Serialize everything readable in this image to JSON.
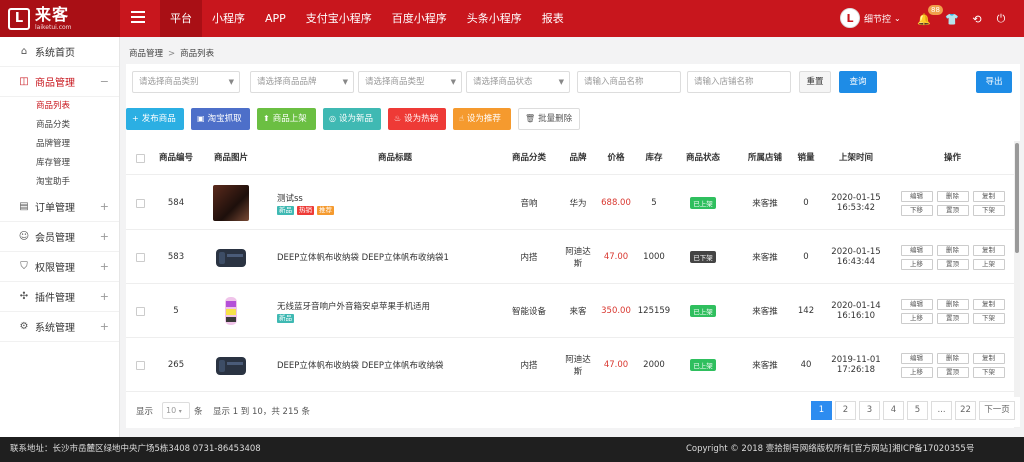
{
  "brand": {
    "logo_cn": "来客",
    "logo_en": "laiketui.com",
    "mark": "L"
  },
  "topnav": [
    "平台",
    "小程序",
    "APP",
    "支付宝小程序",
    "百度小程序",
    "头条小程序",
    "报表"
  ],
  "user": {
    "name": "细节控",
    "avatar_text": "L",
    "notice_count": "88"
  },
  "sidebar": [
    {
      "label": "系统首页",
      "icon": "home-icon",
      "sym": "⌂"
    },
    {
      "label": "商品管理",
      "icon": "shopping-bag-icon",
      "sym": "◫",
      "toggle": "−"
    },
    {
      "label": "订单管理",
      "icon": "order-icon",
      "sym": "▤",
      "toggle": "+"
    },
    {
      "label": "会员管理",
      "icon": "member-icon",
      "sym": "☺",
      "toggle": "+"
    },
    {
      "label": "权限管理",
      "icon": "shield-icon",
      "sym": "⛉",
      "toggle": "+"
    },
    {
      "label": "插件管理",
      "icon": "plugin-icon",
      "sym": "✣",
      "toggle": "+"
    },
    {
      "label": "系统管理",
      "icon": "settings-icon",
      "sym": "⚙",
      "toggle": "+"
    }
  ],
  "submenu": [
    "商品列表",
    "商品分类",
    "品牌管理",
    "库存管理",
    "淘宝助手"
  ],
  "breadcrumb": {
    "parent": "商品管理",
    "sep": ">",
    "current": "商品列表"
  },
  "filters": [
    "请选择商品类别",
    "请选择商品品牌",
    "请选择商品类型",
    "请选择商品状态",
    "请输入商品名称",
    "请输入店铺名称"
  ],
  "buttons": {
    "reset": "重置",
    "query": "查询",
    "export": "导出"
  },
  "actions": [
    {
      "label": "发布商品",
      "icon": "plus-icon",
      "sym": "+",
      "color": "#2bafe3"
    },
    {
      "label": "淘宝抓取",
      "icon": "taobao-icon",
      "sym": "▣",
      "color": "#4d6fc9"
    },
    {
      "label": "商品上架",
      "icon": "upload-icon",
      "sym": "⬆",
      "color": "#6bbf42"
    },
    {
      "label": "设为新品",
      "icon": "new-icon",
      "sym": "◎",
      "color": "#3fb9b3"
    },
    {
      "label": "设为热销",
      "icon": "fire-icon",
      "sym": "♨",
      "color": "#ee3a36"
    },
    {
      "label": "设为推荐",
      "icon": "thumb-up-icon",
      "sym": "☝",
      "color": "#f59a2e"
    },
    {
      "label": "批量删除",
      "icon": "trash-icon",
      "sym": "🗑",
      "color": "#ffffff"
    }
  ],
  "table": {
    "headers": [
      "商品编号",
      "商品图片",
      "商品标题",
      "商品分类",
      "品牌",
      "价格",
      "库存",
      "商品状态",
      "所属店铺",
      "销量",
      "上架时间",
      "操作"
    ],
    "rows": [
      {
        "id": "584",
        "title": "测试ss",
        "tags": [
          {
            "t": "新品",
            "c": "#3fb9b3"
          },
          {
            "t": "热销",
            "c": "#ee3a36"
          },
          {
            "t": "推荐",
            "c": "#f59a2e"
          }
        ],
        "category": "音响",
        "brand": "华为",
        "price": "688.00",
        "stock": "5",
        "status": "已上架",
        "status_color": "#2fbf5e",
        "shop": "来客推",
        "sales": "0",
        "date": "2020-01-15",
        "time": "16:53:42",
        "img": "dark",
        "ops": [
          "编辑",
          "删除",
          "复制",
          "下移",
          "置顶",
          "下架"
        ]
      },
      {
        "id": "583",
        "title": "DEEP立体帆布收纳袋 DEEP立体帆布收纳袋1",
        "tags": [],
        "category": "内搭",
        "brand": "阿迪达斯",
        "price": "47.00",
        "stock": "1000",
        "status": "已下架",
        "status_color": "#444444",
        "shop": "来客推",
        "sales": "0",
        "date": "2020-01-15",
        "time": "16:43:44",
        "img": "box",
        "ops": [
          "编辑",
          "删除",
          "复制",
          "上移",
          "置顶",
          "上架"
        ]
      },
      {
        "id": "5",
        "title": "无线蓝牙音响户外音箱安卓苹果手机适用",
        "tags": [
          {
            "t": "新品",
            "c": "#3fb9b3"
          }
        ],
        "category": "智能设备",
        "brand": "来客",
        "price": "350.00",
        "stock": "125159",
        "status": "已上架",
        "status_color": "#2fbf5e",
        "shop": "来客推",
        "sales": "142",
        "date": "2020-01-14",
        "time": "16:16:10",
        "img": "speaker",
        "ops": [
          "编辑",
          "删除",
          "复制",
          "上移",
          "置顶",
          "下架"
        ]
      },
      {
        "id": "265",
        "title": "DEEP立体帆布收纳袋 DEEP立体帆布收纳袋",
        "tags": [],
        "category": "内搭",
        "brand": "阿迪达斯",
        "price": "47.00",
        "stock": "2000",
        "status": "已上架",
        "status_color": "#2fbf5e",
        "shop": "来客推",
        "sales": "40",
        "date": "2019-11-01",
        "time": "17:26:18",
        "img": "box",
        "ops": [
          "编辑",
          "删除",
          "复制",
          "上移",
          "置顶",
          "下架"
        ]
      }
    ]
  },
  "pager": {
    "show": "显示",
    "per_page": "10",
    "unit": "条",
    "summary": "显示 1 到 10，共 215 条",
    "pages": [
      "1",
      "2",
      "3",
      "4",
      "5",
      "...",
      "22"
    ],
    "next": "下一页"
  },
  "footer": {
    "address": "联系地址：长沙市岳麓区绿地中央广场5栋3408 0731-86453408",
    "copyright": "Copyright © 2018 壹拾捌号网络版权所有[官方网站]",
    "icp": "湘ICP备17020355号"
  }
}
